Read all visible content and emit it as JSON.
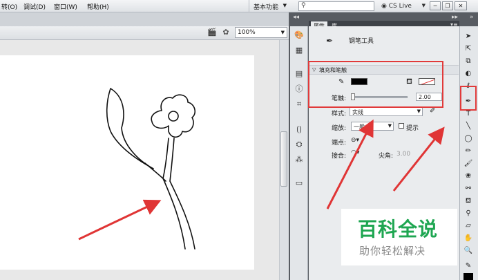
{
  "menu": {
    "items": [
      "转(O)",
      "调试(D)",
      "窗口(W)",
      "帮助(H)"
    ]
  },
  "workspace": {
    "label": "基本功能",
    "caret": "▼"
  },
  "search": {
    "icon": "search-icon",
    "value": ""
  },
  "cs_live": {
    "label": "CS Live",
    "caret": "▼"
  },
  "window_buttons": [
    "minimize",
    "restore",
    "close"
  ],
  "stage": {
    "zoom": "100%",
    "zoom_caret": "▼"
  },
  "panel": {
    "tabs": [
      "属性",
      "库"
    ],
    "tool_name": "钢笔工具",
    "section_title": "填充和笔触",
    "stroke_label": "笔触:",
    "stroke_value": "2.00",
    "style_label": "样式:",
    "style_value": "实线",
    "scale_label": "缩放:",
    "scale_value": "一般",
    "hint_label": "提示",
    "cap_label": "端点:",
    "join_label": "接合:",
    "miter_label": "尖角:",
    "miter_value": "3.00"
  },
  "colors": {
    "stroke": "#000000",
    "fill": "none",
    "highlight": "#e13a3a",
    "watermark_green": "#1ea651"
  },
  "watermark": {
    "title": "百科全说",
    "subtitle": "助你轻松解决"
  }
}
